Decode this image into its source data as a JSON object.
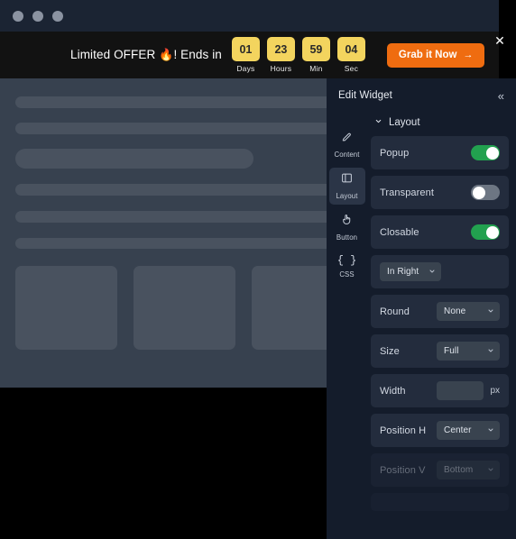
{
  "browser_chrome": {
    "dots": [
      "window-dot-1",
      "window-dot-2",
      "window-dot-3"
    ]
  },
  "promo_banner": {
    "message": "Limited OFFER",
    "flame_icon": "🔥",
    "message_suffix": "! Ends in",
    "countdown": [
      {
        "value": "01",
        "label": "Days"
      },
      {
        "value": "23",
        "label": "Hours"
      },
      {
        "value": "59",
        "label": "Min"
      },
      {
        "value": "04",
        "label": "Sec"
      }
    ],
    "cta_label": "Grab it Now",
    "cta_arrow": "→",
    "close_label": "✕",
    "colors": {
      "countdown_box": "#f3d45e",
      "cta_background": "#ef6c10",
      "banner_background": "#121212"
    }
  },
  "preview": {
    "description": "page content skeleton placeholder",
    "bars": 6,
    "cards": 3
  },
  "panel": {
    "title": "Edit Widget",
    "collapse_icon": "«",
    "tabs": [
      {
        "id": "content",
        "label": "Content",
        "icon": "edit-pencil-icon",
        "active": false
      },
      {
        "id": "layout",
        "label": "Layout",
        "icon": "panel-layout-icon",
        "active": true
      },
      {
        "id": "button",
        "label": "Button",
        "icon": "cursor-click-icon",
        "active": false
      },
      {
        "id": "css",
        "label": "CSS",
        "icon": "curly-braces-icon",
        "glyph": "{ }",
        "active": false
      }
    ],
    "section": {
      "title": "Layout",
      "expanded": true,
      "chevron": "⌄"
    },
    "controls": {
      "popup": {
        "label": "Popup",
        "type": "toggle",
        "value": "on"
      },
      "transparent": {
        "label": "Transparent",
        "type": "toggle",
        "value": "off"
      },
      "closable": {
        "label": "Closable",
        "type": "toggle",
        "value": "on"
      },
      "placement": {
        "label": "",
        "type": "select",
        "value": "In Right"
      },
      "round": {
        "label": "Round",
        "type": "select",
        "value": "None"
      },
      "size": {
        "label": "Size",
        "type": "select",
        "value": "Full"
      },
      "width": {
        "label": "Width",
        "type": "text",
        "value": "",
        "placeholder": "",
        "unit": "px"
      },
      "position_h": {
        "label": "Position H",
        "type": "select",
        "value": "Center"
      },
      "position_v": {
        "label": "Position V",
        "type": "select",
        "value": "Bottom",
        "disabled": true
      }
    },
    "colors": {
      "panel_background": "#141c2b",
      "row_background": "#232c3d",
      "toggle_on": "#22a14f",
      "toggle_off": "#6d7683",
      "active_tab": "#2b3547"
    }
  }
}
